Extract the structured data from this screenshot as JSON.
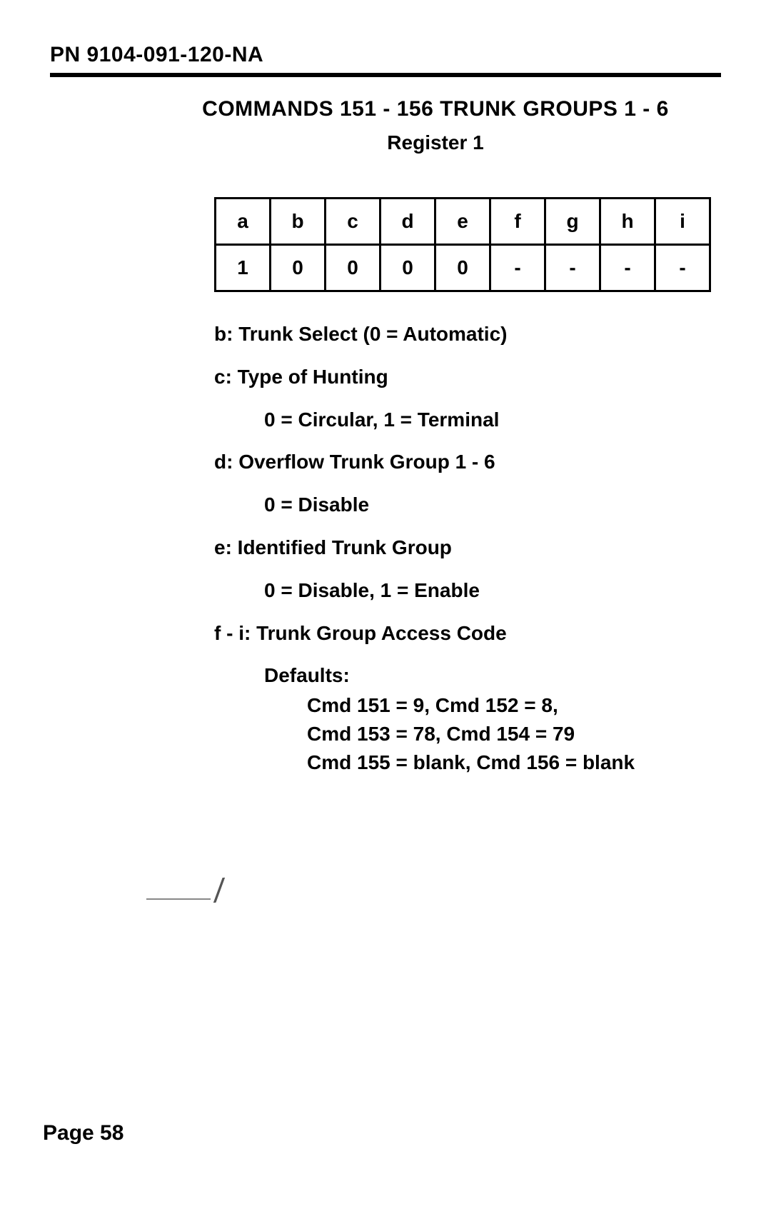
{
  "header": {
    "doc_number": "PN 9104-091-120-NA"
  },
  "title": "COMMANDS 151 - 156 TRUNK GROUPS 1 - 6",
  "subtitle": "Register 1",
  "chart_data": {
    "type": "table",
    "title": "Register 1",
    "columns": [
      "a",
      "b",
      "c",
      "d",
      "e",
      "f",
      "g",
      "h",
      "i"
    ],
    "rows": [
      [
        "1",
        "0",
        "0",
        "0",
        "0",
        "-",
        "-",
        "-",
        "-"
      ]
    ]
  },
  "defs": {
    "b": "b: Trunk Select (0 = Automatic)",
    "c": "c: Type of Hunting",
    "c_sub": "0 = Circular, 1 = Terminal",
    "d": "d: Overflow Trunk Group 1 - 6",
    "d_sub": "0 = Disable",
    "e": "e: Identified Trunk Group",
    "e_sub": "0 = Disable, 1 = Enable",
    "f": "f - i: Trunk Group Access Code",
    "defaults_label": "Defaults:",
    "defaults_lines": [
      "Cmd 151 = 9, Cmd 152 = 8,",
      "Cmd 153 = 78, Cmd 154 = 79",
      "Cmd 155 = blank, Cmd 156 = blank"
    ]
  },
  "footer": {
    "page": "Page 58"
  }
}
